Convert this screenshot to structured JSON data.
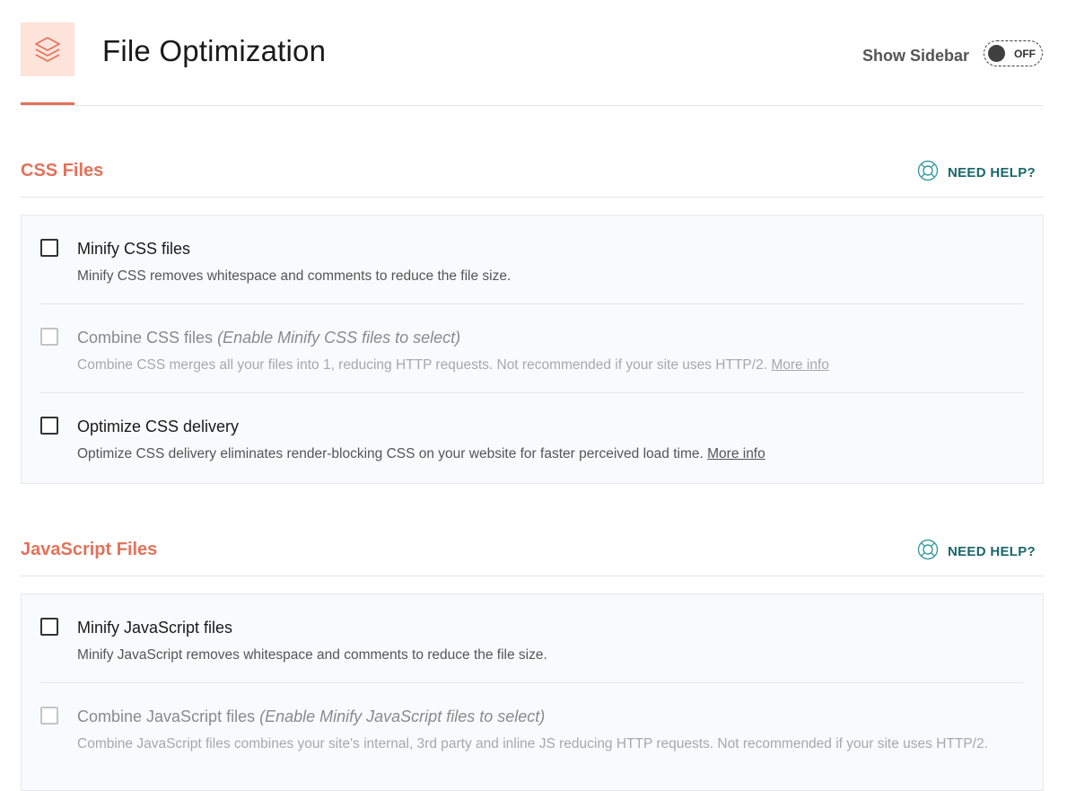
{
  "header": {
    "title": "File Optimization",
    "show_sidebar_label": "Show Sidebar",
    "toggle_state": "OFF"
  },
  "sections": [
    {
      "title": "CSS Files",
      "help_label": "NEED HELP?",
      "options": [
        {
          "title": "Minify CSS files",
          "note": "",
          "description": "Minify CSS removes whitespace and comments to reduce the file size.",
          "link": "",
          "checked": false,
          "disabled": false
        },
        {
          "title": "Combine CSS files",
          "note": "(Enable Minify CSS files to select)",
          "description": "Combine CSS merges all your files into 1, reducing HTTP requests. Not recommended if your site uses HTTP/2.",
          "link": "More info",
          "checked": false,
          "disabled": true
        },
        {
          "title": "Optimize CSS delivery",
          "note": "",
          "description": "Optimize CSS delivery eliminates render-blocking CSS on your website for faster perceived load time.",
          "link": "More info",
          "checked": false,
          "disabled": false
        }
      ]
    },
    {
      "title": "JavaScript Files",
      "help_label": "NEED HELP?",
      "options": [
        {
          "title": "Minify JavaScript files",
          "note": "",
          "description": "Minify JavaScript removes whitespace and comments to reduce the file size.",
          "link": "",
          "checked": false,
          "disabled": false
        },
        {
          "title": "Combine JavaScript files",
          "note": "(Enable Minify JavaScript files to select)",
          "description": "Combine JavaScript files combines your site's internal, 3rd party and inline JS reducing HTTP requests. Not recommended if your site uses HTTP/2.",
          "link": "",
          "checked": false,
          "disabled": true
        }
      ]
    }
  ],
  "colors": {
    "accent": "#e2725b",
    "help": "#19666b",
    "icon_bg": "#fde3da"
  },
  "icons": {
    "header": "layers-icon",
    "help": "lifebuoy-icon"
  }
}
